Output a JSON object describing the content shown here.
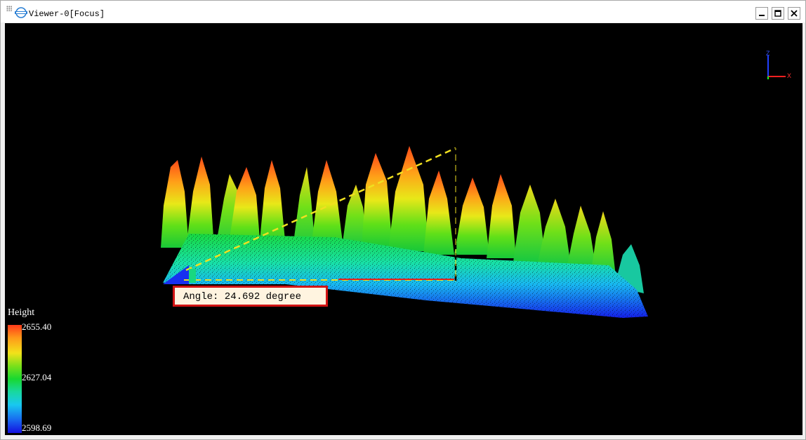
{
  "window": {
    "title": "Viewer-0[Focus]",
    "controls": {
      "minimize": "minimize",
      "maximize": "maximize",
      "close": "close"
    }
  },
  "measurement": {
    "label": "Angle: 24.692 degree"
  },
  "axes": {
    "x_label": "X",
    "z_label": "Z",
    "x_color": "#ff2020",
    "y_color": "#20ff20",
    "z_color": "#2040ff"
  },
  "legend": {
    "title": "Height",
    "max": "2655.40",
    "mid": "2627.04",
    "min": "2598.69"
  },
  "colors": {
    "viewport_bg": "#000000",
    "label_border": "#d11414",
    "label_bg": "#fff4e0",
    "measure_line": "#f0e020",
    "baseline": "#e02020"
  }
}
